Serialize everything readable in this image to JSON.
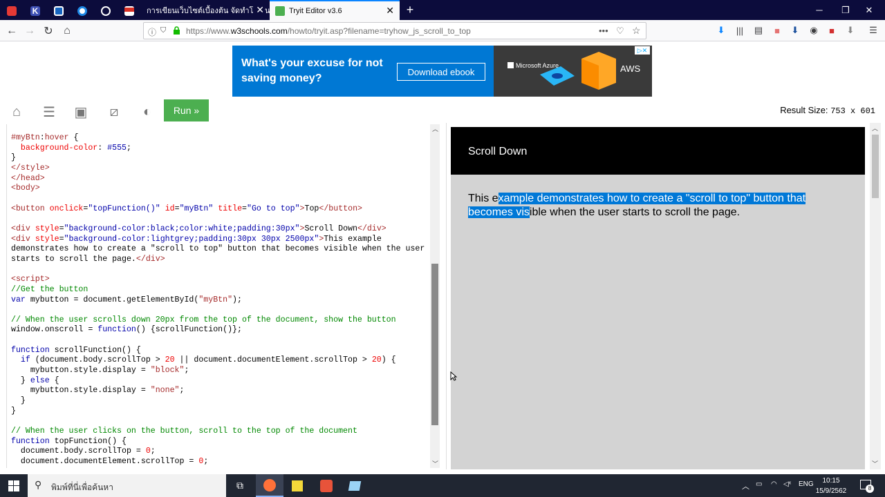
{
  "browser": {
    "tabs": [
      {
        "label": "การเขียนเว็บไซต์เบื้องต้น จัดทำโดย นางส"
      },
      {
        "label": "Tryit Editor v3.6"
      }
    ],
    "url_prefix": "https://www.",
    "url_domain": "w3schools.com",
    "url_path": "/howto/tryit.asp?filename=tryhow_js_scroll_to_top"
  },
  "ad": {
    "headline": "What's your excuse for not saving money?",
    "button": "Download ebook",
    "brand1": "Microsoft Azure",
    "brand2": "AWS"
  },
  "toolbar": {
    "run_label": "Run »",
    "result_size_label": "Result Size:",
    "result_size_value": "753 x 601"
  },
  "result": {
    "header_text": "Scroll Down",
    "body_before": "This e",
    "body_selected": "xample demonstrates how to create a \"scroll to top\" button that becomes vis",
    "body_after": "ible when the user starts to scroll the page."
  },
  "taskbar": {
    "search_placeholder": "พิมพ์ที่นี่เพื่อค้นหา",
    "language": "ENG",
    "time": "10:15",
    "date": "15/9/2562",
    "notification_count": "8"
  },
  "colors": {
    "run_green": "#4caf50",
    "selection_blue": "#0078d7",
    "ad_blue": "#0078d4"
  }
}
